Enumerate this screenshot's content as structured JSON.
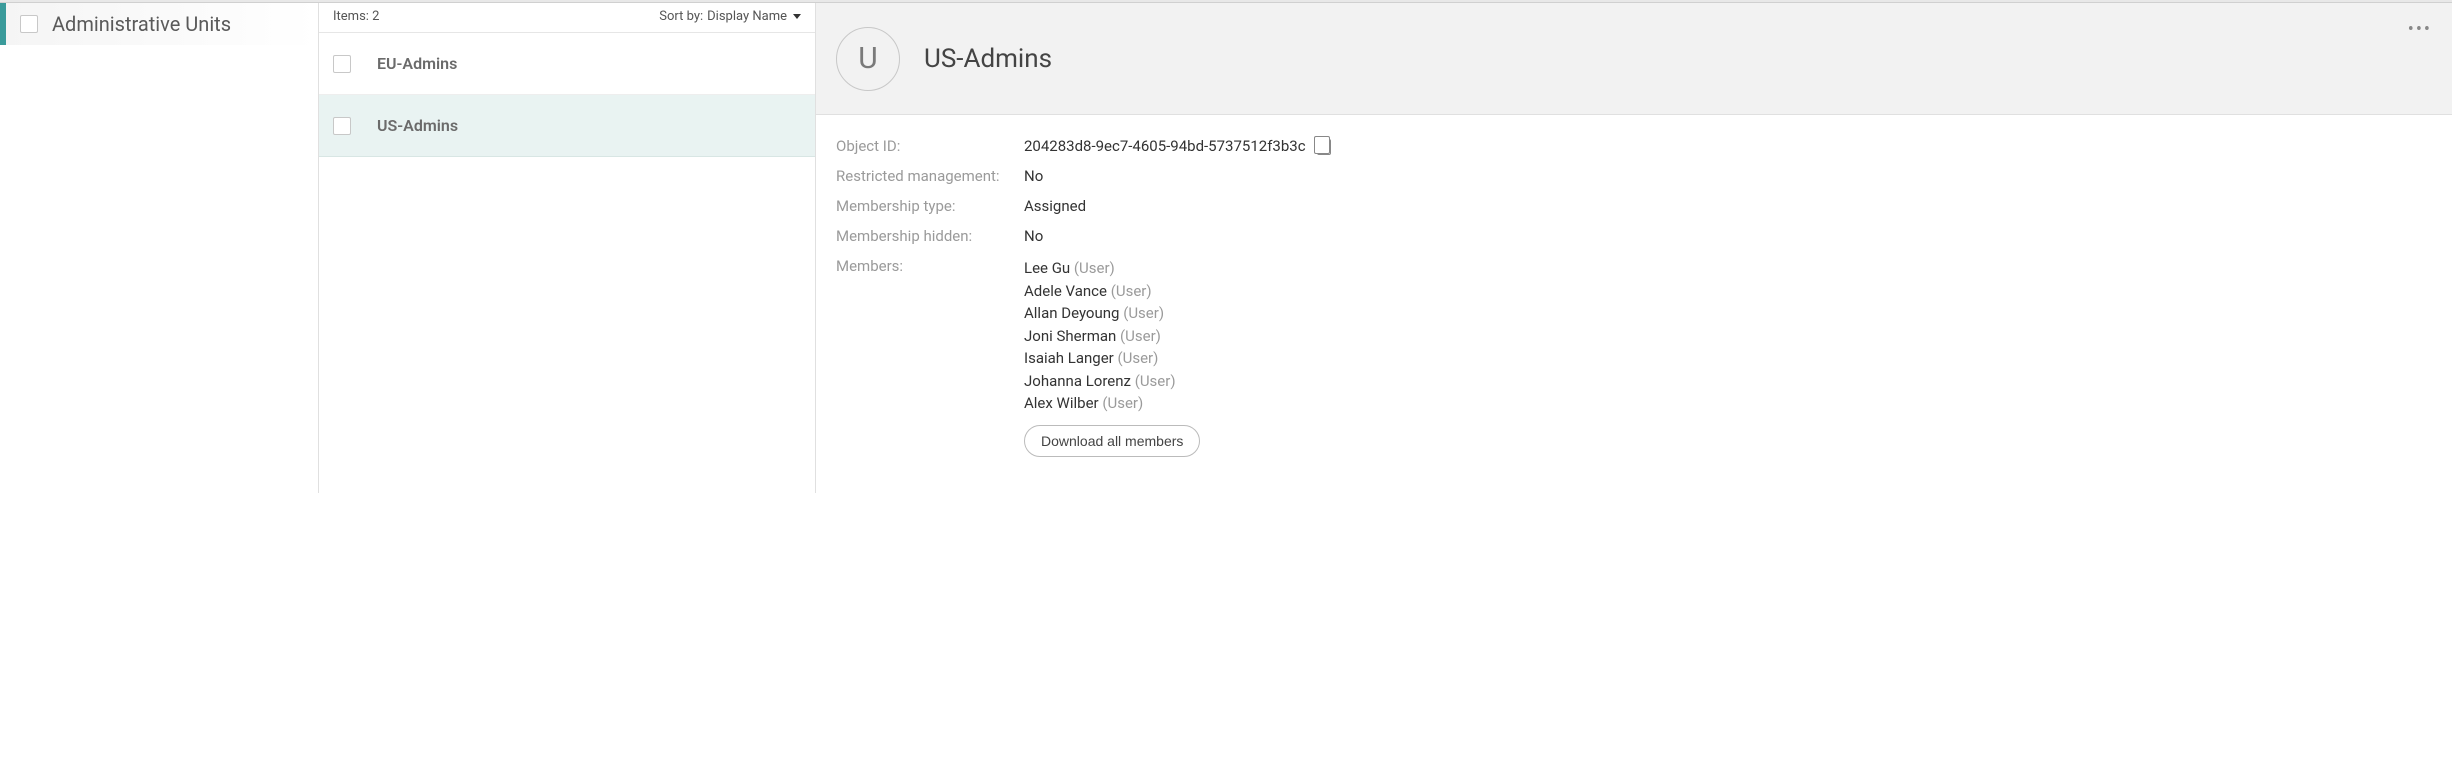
{
  "sidebar": {
    "label": "Administrative Units"
  },
  "list": {
    "items_label": "Items: 2",
    "sort_prefix": "Sort by:",
    "sort_value": "Display Name",
    "rows": [
      {
        "name": "EU-Admins",
        "selected": false
      },
      {
        "name": "US-Admins",
        "selected": true
      }
    ]
  },
  "detail": {
    "avatar_initial": "U",
    "title": "US-Admins",
    "labels": {
      "object_id": "Object ID:",
      "restricted": "Restricted management:",
      "membership_type": "Membership type:",
      "membership_hidden": "Membership hidden:",
      "members": "Members:"
    },
    "values": {
      "object_id": "204283d8-9ec7-4605-94bd-5737512f3b3c",
      "restricted": "No",
      "membership_type": "Assigned",
      "membership_hidden": "No"
    },
    "members": [
      {
        "name": "Lee Gu",
        "type": "(User)"
      },
      {
        "name": "Adele Vance",
        "type": "(User)"
      },
      {
        "name": "Allan Deyoung",
        "type": "(User)"
      },
      {
        "name": "Joni Sherman",
        "type": "(User)"
      },
      {
        "name": "Isaiah Langer",
        "type": "(User)"
      },
      {
        "name": "Johanna Lorenz",
        "type": "(User)"
      },
      {
        "name": "Alex Wilber",
        "type": "(User)"
      }
    ],
    "download_label": "Download all members"
  }
}
